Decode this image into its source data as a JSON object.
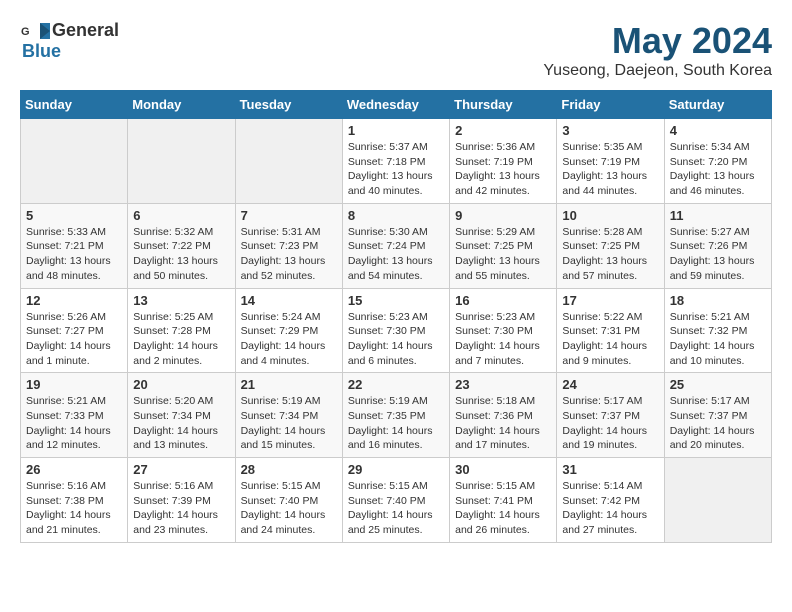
{
  "header": {
    "logo_general": "General",
    "logo_blue": "Blue",
    "month": "May 2024",
    "location": "Yuseong, Daejeon, South Korea"
  },
  "weekdays": [
    "Sunday",
    "Monday",
    "Tuesday",
    "Wednesday",
    "Thursday",
    "Friday",
    "Saturday"
  ],
  "weeks": [
    [
      {
        "day": "",
        "info": ""
      },
      {
        "day": "",
        "info": ""
      },
      {
        "day": "",
        "info": ""
      },
      {
        "day": "1",
        "info": "Sunrise: 5:37 AM\nSunset: 7:18 PM\nDaylight: 13 hours\nand 40 minutes."
      },
      {
        "day": "2",
        "info": "Sunrise: 5:36 AM\nSunset: 7:19 PM\nDaylight: 13 hours\nand 42 minutes."
      },
      {
        "day": "3",
        "info": "Sunrise: 5:35 AM\nSunset: 7:19 PM\nDaylight: 13 hours\nand 44 minutes."
      },
      {
        "day": "4",
        "info": "Sunrise: 5:34 AM\nSunset: 7:20 PM\nDaylight: 13 hours\nand 46 minutes."
      }
    ],
    [
      {
        "day": "5",
        "info": "Sunrise: 5:33 AM\nSunset: 7:21 PM\nDaylight: 13 hours\nand 48 minutes."
      },
      {
        "day": "6",
        "info": "Sunrise: 5:32 AM\nSunset: 7:22 PM\nDaylight: 13 hours\nand 50 minutes."
      },
      {
        "day": "7",
        "info": "Sunrise: 5:31 AM\nSunset: 7:23 PM\nDaylight: 13 hours\nand 52 minutes."
      },
      {
        "day": "8",
        "info": "Sunrise: 5:30 AM\nSunset: 7:24 PM\nDaylight: 13 hours\nand 54 minutes."
      },
      {
        "day": "9",
        "info": "Sunrise: 5:29 AM\nSunset: 7:25 PM\nDaylight: 13 hours\nand 55 minutes."
      },
      {
        "day": "10",
        "info": "Sunrise: 5:28 AM\nSunset: 7:25 PM\nDaylight: 13 hours\nand 57 minutes."
      },
      {
        "day": "11",
        "info": "Sunrise: 5:27 AM\nSunset: 7:26 PM\nDaylight: 13 hours\nand 59 minutes."
      }
    ],
    [
      {
        "day": "12",
        "info": "Sunrise: 5:26 AM\nSunset: 7:27 PM\nDaylight: 14 hours\nand 1 minute."
      },
      {
        "day": "13",
        "info": "Sunrise: 5:25 AM\nSunset: 7:28 PM\nDaylight: 14 hours\nand 2 minutes."
      },
      {
        "day": "14",
        "info": "Sunrise: 5:24 AM\nSunset: 7:29 PM\nDaylight: 14 hours\nand 4 minutes."
      },
      {
        "day": "15",
        "info": "Sunrise: 5:23 AM\nSunset: 7:30 PM\nDaylight: 14 hours\nand 6 minutes."
      },
      {
        "day": "16",
        "info": "Sunrise: 5:23 AM\nSunset: 7:30 PM\nDaylight: 14 hours\nand 7 minutes."
      },
      {
        "day": "17",
        "info": "Sunrise: 5:22 AM\nSunset: 7:31 PM\nDaylight: 14 hours\nand 9 minutes."
      },
      {
        "day": "18",
        "info": "Sunrise: 5:21 AM\nSunset: 7:32 PM\nDaylight: 14 hours\nand 10 minutes."
      }
    ],
    [
      {
        "day": "19",
        "info": "Sunrise: 5:21 AM\nSunset: 7:33 PM\nDaylight: 14 hours\nand 12 minutes."
      },
      {
        "day": "20",
        "info": "Sunrise: 5:20 AM\nSunset: 7:34 PM\nDaylight: 14 hours\nand 13 minutes."
      },
      {
        "day": "21",
        "info": "Sunrise: 5:19 AM\nSunset: 7:34 PM\nDaylight: 14 hours\nand 15 minutes."
      },
      {
        "day": "22",
        "info": "Sunrise: 5:19 AM\nSunset: 7:35 PM\nDaylight: 14 hours\nand 16 minutes."
      },
      {
        "day": "23",
        "info": "Sunrise: 5:18 AM\nSunset: 7:36 PM\nDaylight: 14 hours\nand 17 minutes."
      },
      {
        "day": "24",
        "info": "Sunrise: 5:17 AM\nSunset: 7:37 PM\nDaylight: 14 hours\nand 19 minutes."
      },
      {
        "day": "25",
        "info": "Sunrise: 5:17 AM\nSunset: 7:37 PM\nDaylight: 14 hours\nand 20 minutes."
      }
    ],
    [
      {
        "day": "26",
        "info": "Sunrise: 5:16 AM\nSunset: 7:38 PM\nDaylight: 14 hours\nand 21 minutes."
      },
      {
        "day": "27",
        "info": "Sunrise: 5:16 AM\nSunset: 7:39 PM\nDaylight: 14 hours\nand 23 minutes."
      },
      {
        "day": "28",
        "info": "Sunrise: 5:15 AM\nSunset: 7:40 PM\nDaylight: 14 hours\nand 24 minutes."
      },
      {
        "day": "29",
        "info": "Sunrise: 5:15 AM\nSunset: 7:40 PM\nDaylight: 14 hours\nand 25 minutes."
      },
      {
        "day": "30",
        "info": "Sunrise: 5:15 AM\nSunset: 7:41 PM\nDaylight: 14 hours\nand 26 minutes."
      },
      {
        "day": "31",
        "info": "Sunrise: 5:14 AM\nSunset: 7:42 PM\nDaylight: 14 hours\nand 27 minutes."
      },
      {
        "day": "",
        "info": ""
      }
    ]
  ]
}
